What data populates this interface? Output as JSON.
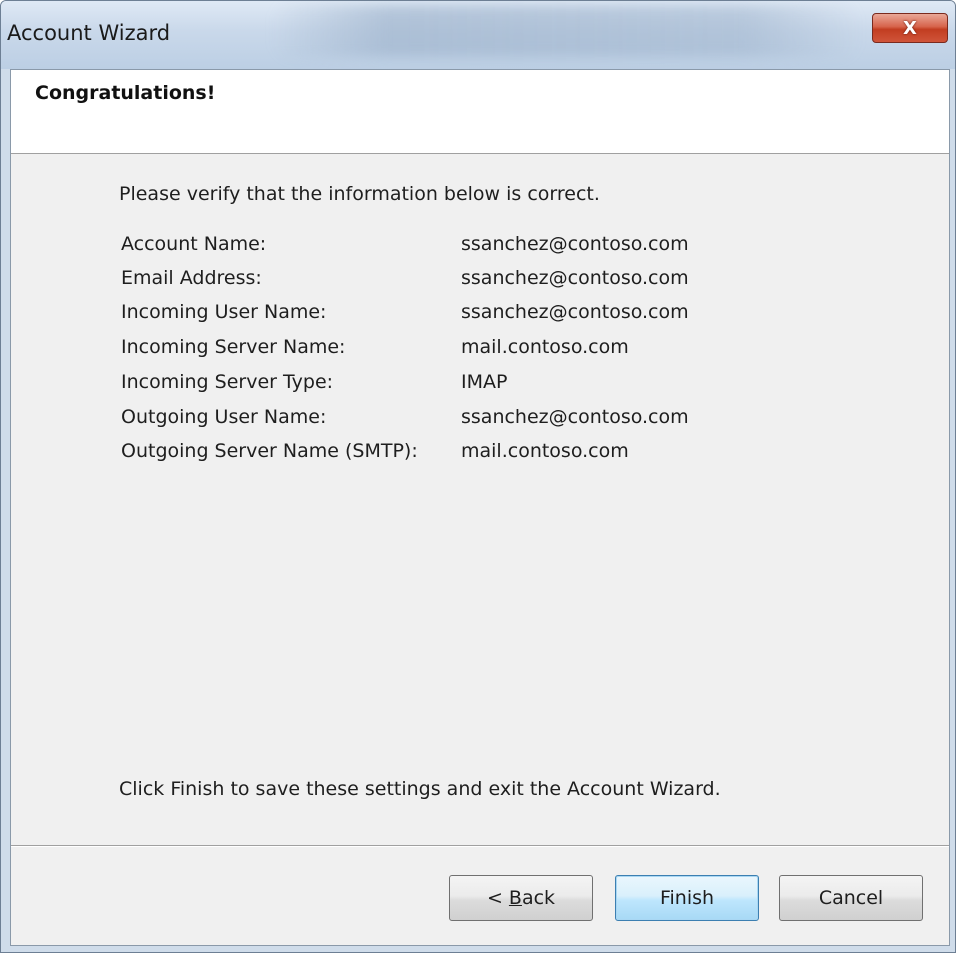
{
  "window": {
    "title": "Account Wizard",
    "close_glyph": "X"
  },
  "header": {
    "title": "Congratulations!"
  },
  "main": {
    "intro": "Please verify that the information below is correct.",
    "details": [
      {
        "label": "Account Name:",
        "value": "ssanchez@contoso.com"
      },
      {
        "label": "Email Address:",
        "value": "ssanchez@contoso.com"
      },
      {
        "label": "Incoming User Name:",
        "value": "ssanchez@contoso.com"
      },
      {
        "label": "Incoming Server Name:",
        "value": "mail.contoso.com"
      },
      {
        "label": "Incoming Server Type:",
        "value": "IMAP"
      },
      {
        "label": "Outgoing User Name:",
        "value": "ssanchez@contoso.com"
      },
      {
        "label": "Outgoing Server Name (SMTP):",
        "value": "mail.contoso.com"
      }
    ],
    "footer": "Click Finish to save these settings and exit the Account Wizard."
  },
  "buttons": {
    "back_prefix": "< ",
    "back_access_key": "B",
    "back_rest": "ack",
    "finish": "Finish",
    "cancel": "Cancel"
  },
  "colors": {
    "finish_border": "#3c7fb1",
    "close_red": "#c23d21"
  }
}
